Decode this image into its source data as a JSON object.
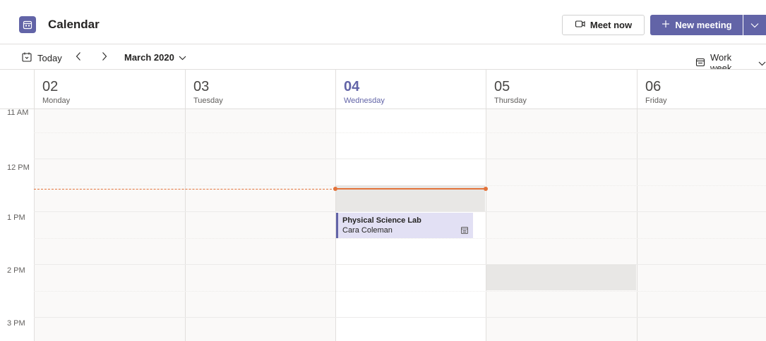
{
  "app": {
    "title": "Calendar",
    "icon": "calendar-app-icon",
    "accent": "#6264a7"
  },
  "toolbar": {
    "meet_now_label": "Meet now",
    "new_meeting_label": "New meeting"
  },
  "nav": {
    "today_label": "Today",
    "month_label": "March 2020",
    "view_label": "Work week"
  },
  "days": [
    {
      "num": "02",
      "name": "Monday"
    },
    {
      "num": "03",
      "name": "Tuesday"
    },
    {
      "num": "04",
      "name": "Wednesday"
    },
    {
      "num": "05",
      "name": "Thursday"
    },
    {
      "num": "06",
      "name": "Friday"
    }
  ],
  "times": [
    "11 AM",
    "12 PM",
    "1 PM",
    "2 PM",
    "3 PM"
  ],
  "event": {
    "title": "Physical Science Lab",
    "organizer": "Cara Coleman",
    "color": "#e2e0f4"
  },
  "current_time_color": "#e3733a"
}
